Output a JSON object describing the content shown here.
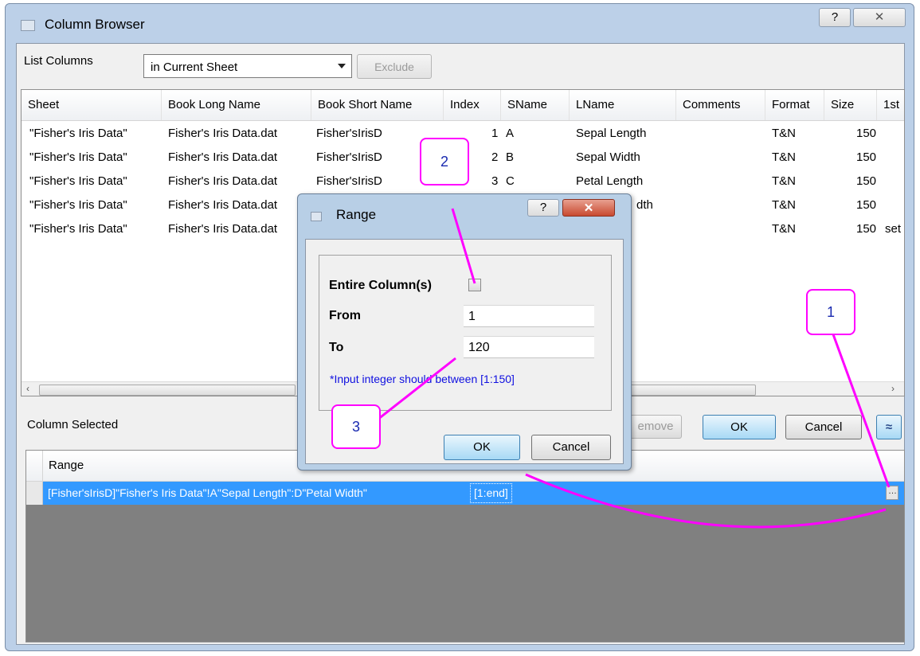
{
  "window": {
    "title": "Column Browser",
    "help_glyph": "?",
    "close_glyph": "✕"
  },
  "toolbar": {
    "list_label": "List Columns",
    "scope_value": "in Current Sheet",
    "exclude_label": "Exclude"
  },
  "columns_table": {
    "headers": [
      "Sheet",
      "Book Long Name",
      "Book Short Name",
      "Index",
      "SName",
      "LName",
      "Comments",
      "Format",
      "Size",
      "1st"
    ],
    "rows": [
      {
        "sheet": "\"Fisher's Iris Data\"",
        "long": "Fisher's Iris Data.dat",
        "short": "Fisher'sIrisD",
        "index": "1",
        "sname": "A",
        "lname": "Sepal Length",
        "format": "T&N",
        "size": "150",
        "first": ""
      },
      {
        "sheet": "\"Fisher's Iris Data\"",
        "long": "Fisher's Iris Data.dat",
        "short": "Fisher'sIrisD",
        "index": "2",
        "sname": "B",
        "lname": "Sepal Width",
        "format": "T&N",
        "size": "150",
        "first": ""
      },
      {
        "sheet": "\"Fisher's Iris Data\"",
        "long": "Fisher's Iris Data.dat",
        "short": "Fisher'sIrisD",
        "index": "3",
        "sname": "C",
        "lname": "Petal Length",
        "format": "T&N",
        "size": "150",
        "first": ""
      },
      {
        "sheet": "\"Fisher's Iris Data\"",
        "long": "Fisher's Iris Data.dat",
        "short": "",
        "index": "",
        "sname": "",
        "lname": "dth",
        "format": "T&N",
        "size": "150",
        "first": ""
      },
      {
        "sheet": "\"Fisher's Iris Data\"",
        "long": "Fisher's Iris Data.dat",
        "short": "",
        "index": "",
        "sname": "",
        "lname": "",
        "format": "T&N",
        "size": "150",
        "first": "set"
      }
    ]
  },
  "selected": {
    "label": "Column Selected",
    "remove_label": "emove",
    "ok_label": "OK",
    "cancel_label": "Cancel",
    "collapse_glyph": "≈",
    "range_header": "Range",
    "range_value": "[Fisher'sIrisD]\"Fisher's Iris Data\"!A\"Sepal Length\":D\"Petal Width\"",
    "range_suffix": "[1:end]"
  },
  "range_dialog": {
    "title": "Range",
    "help_glyph": "?",
    "close_glyph": "✕",
    "entire_label": "Entire Column(s)",
    "entire_checked": false,
    "from_label": "From",
    "from_value": "1",
    "to_label": "To",
    "to_value": "120",
    "hint": "*Input integer should between [1:150]",
    "ok_label": "OK",
    "cancel_label": "Cancel"
  },
  "callouts": [
    "1",
    "2",
    "3"
  ],
  "colors": {
    "callout": "#ff00ff",
    "selection": "#3399ff",
    "hint": "#1010e0"
  }
}
